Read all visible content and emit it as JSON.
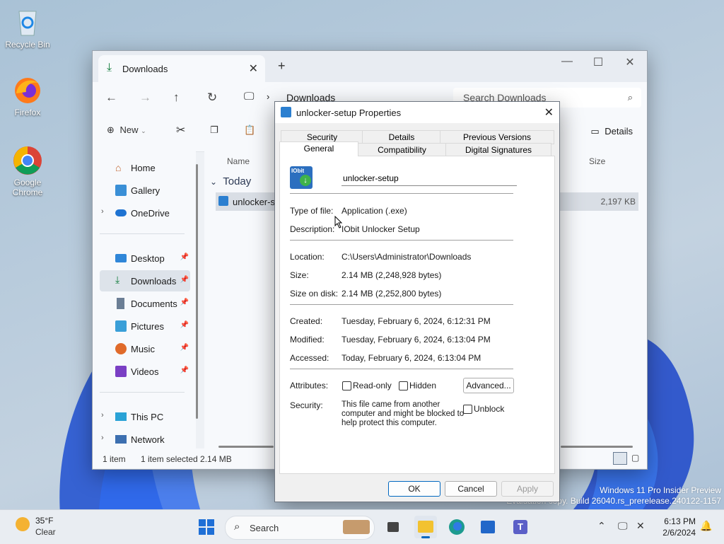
{
  "desktop": {
    "icons": [
      {
        "label": "Recycle Bin"
      },
      {
        "label": "Firefox"
      },
      {
        "label": "Google Chrome"
      }
    ],
    "watermark": [
      "Windows 11 Pro Insider Preview",
      "Evaluation copy. Build 26040.rs_prerelease.240122-1157"
    ]
  },
  "explorer": {
    "tab_label": "Downloads",
    "breadcrumb": "Downloads",
    "search_placeholder": "Search Downloads",
    "toolbar": {
      "new_label": "New",
      "details_label": "Details"
    },
    "nav": {
      "home": "Home",
      "gallery": "Gallery",
      "onedrive": "OneDrive",
      "desktop": "Desktop",
      "downloads": "Downloads",
      "documents": "Documents",
      "pictures": "Pictures",
      "music": "Music",
      "videos": "Videos",
      "thispc": "This PC",
      "network": "Network"
    },
    "columns": {
      "name": "Name",
      "size": "Size"
    },
    "group": "Today",
    "file": {
      "name": "unlocker-se",
      "size": "2,197 KB"
    },
    "status": {
      "count": "1 item",
      "selected": "1 item selected  2.14 MB"
    }
  },
  "properties": {
    "title": "unlocker-setup Properties",
    "tabs_row1": [
      "Security",
      "Details",
      "Previous Versions"
    ],
    "tabs_row2": [
      "General",
      "Compatibility",
      "Digital Signatures"
    ],
    "active_tab": "General",
    "file_name": "unlocker-setup",
    "icon_text": "IObit",
    "type_label": "Type of file:",
    "type_value": "Application (.exe)",
    "desc_label": "Description:",
    "desc_value": "IObit Unlocker Setup",
    "location_label": "Location:",
    "location_value": "C:\\Users\\Administrator\\Downloads",
    "size_label": "Size:",
    "size_value": "2.14 MB (2,248,928 bytes)",
    "sizedisk_label": "Size on disk:",
    "sizedisk_value": "2.14 MB (2,252,800 bytes)",
    "created_label": "Created:",
    "created_value": "Tuesday, February 6, 2024, 6:12:31 PM",
    "modified_label": "Modified:",
    "modified_value": "Tuesday, February 6, 2024, 6:13:04 PM",
    "accessed_label": "Accessed:",
    "accessed_value": "Today, February 6, 2024, 6:13:04 PM",
    "attributes_label": "Attributes:",
    "readonly_label": "Read-only",
    "hidden_label": "Hidden",
    "advanced_label": "Advanced...",
    "security_label": "Security:",
    "security_text": [
      "This file came from another",
      "computer and might be blocked to",
      "help protect this computer."
    ],
    "unblock_label": "Unblock",
    "ok_label": "OK",
    "cancel_label": "Cancel",
    "apply_label": "Apply"
  },
  "taskbar": {
    "temp": "35°F",
    "condition": "Clear",
    "search_label": "Search",
    "time": "6:13 PM",
    "date": "2/6/2024"
  },
  "colors": {
    "accent": "#0067c0",
    "taskbar": "#e9edf2"
  }
}
